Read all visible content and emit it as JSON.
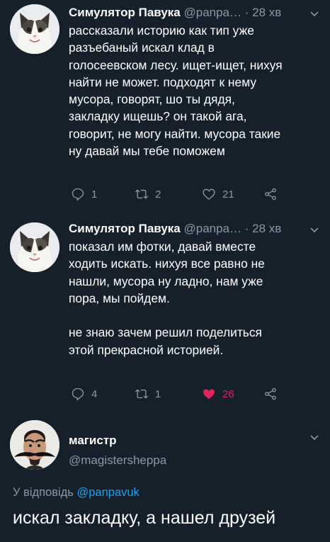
{
  "tweets": [
    {
      "author_name": "Симулятор Павука",
      "author_meta": "@panpa… · 28 хв",
      "text_lines": [
        "рассказали историю как тип уже",
        "разъебаный искал клад в",
        "голосеевском лесу. ищет-ищет, нихуя",
        "найти не может. подходят к нему",
        "мусора, говорят, шо ты дядя,",
        "закладку ищешь? он такой ага,",
        "говорит, не могу найти. мусора такие",
        "ну давай мы тебе поможем"
      ],
      "reply_count": "1",
      "retweet_count": "2",
      "like_count": "21",
      "liked": false
    },
    {
      "author_name": "Симулятор Павука",
      "author_meta": "@panpa… · 28 хв",
      "text_lines": [
        "показал им фотки, давай вместе",
        "ходить искать. нихуя все равно не",
        "нашли, мусора ну ладно, нам уже",
        "пора, мы пойдем.",
        "",
        "не знаю зачем решил поделиться",
        "этой прекрасной историей."
      ],
      "reply_count": "4",
      "retweet_count": "1",
      "like_count": "26",
      "liked": true
    }
  ],
  "reply": {
    "author_name": "магистр",
    "author_handle": "@magistersheppa",
    "replying_to_prefix": "У відповідь ",
    "replying_to_handle": "@panpavuk",
    "text": "искал закладку, а нашел друзей"
  },
  "colors": {
    "background": "#15202b",
    "secondary_text": "#8899a6",
    "link": "#1da1f2",
    "like_active": "#e0245e"
  },
  "icons": [
    "cat-avatar",
    "man-avatar",
    "reply-icon",
    "retweet-icon",
    "heart-icon",
    "share-icon",
    "chevron-down-icon"
  ]
}
